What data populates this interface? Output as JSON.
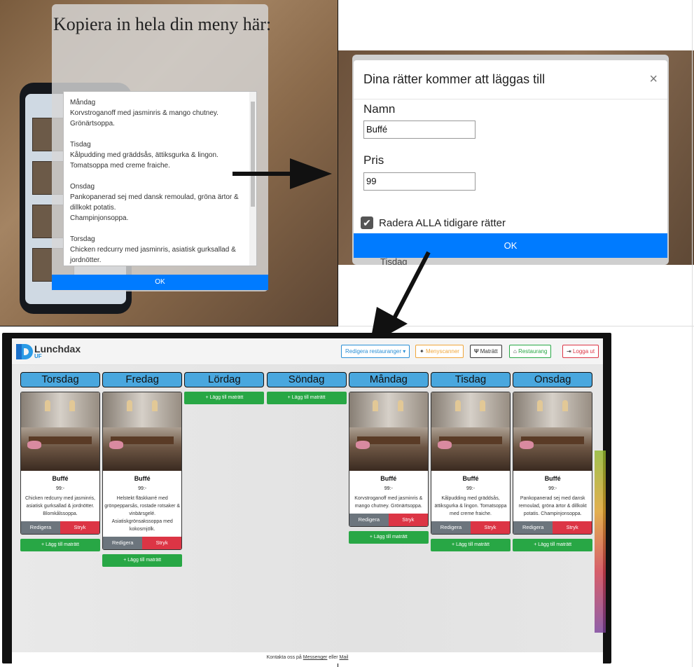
{
  "menu_paste": {
    "title": "Kopiera in hela din meny här:",
    "days": [
      {
        "day": "Måndag",
        "lines": [
          "Korvstroganoff med jasminris & mango chutney.",
          "Grönärtsoppa."
        ]
      },
      {
        "day": "Tisdag",
        "lines": [
          "Kålpudding med gräddsås, ättiksgurka & lingon.",
          "Tomatsoppa med creme fraiche."
        ]
      },
      {
        "day": "Onsdag",
        "lines": [
          "Pankopanerad sej med dansk remoulad, gröna ärtor & dillkokt potatis.",
          "Champinjonsoppa."
        ]
      },
      {
        "day": "Torsdag",
        "lines": [
          "Chicken redcurry med jasminris, asiatisk gurksallad & jordnötter."
        ]
      }
    ],
    "ok_label": "OK"
  },
  "dish_dialog": {
    "title": "Dina rätter kommer att läggas till",
    "close_symbol": "×",
    "name_label": "Namn",
    "name_value": "Buffé",
    "price_label": "Pris",
    "price_value": "99",
    "delete_all_label": "Radera ALLA tidigare rätter",
    "delete_all_checked": true,
    "ok_label": "OK",
    "background_day": "Tisdag"
  },
  "app": {
    "brand": "Lunchdax",
    "brand_sub": "UF",
    "nav": {
      "edit_restaurants": "Redigera restauranger",
      "menu_scanner": "Menyscanner",
      "dish": "Maträtt",
      "restaurant": "Restaurang",
      "logout": "Logga ut"
    },
    "nav_colors": {
      "edit_restaurants": "#2a8fd6",
      "menu_scanner": "#f0a63a",
      "dish": "#333333",
      "restaurant": "#28a745",
      "logout": "#dc3545"
    },
    "edit_label": "Redigera",
    "delete_label": "Stryk",
    "add_label": "+ Lägg till maträtt",
    "days": [
      {
        "name": "Torsdag",
        "dish": {
          "name": "Buffé",
          "price": "99:-",
          "desc": "Chicken redcurry med jasminris, asiatisk gurksallad & jordnötter. Blomkålssoppa."
        }
      },
      {
        "name": "Fredag",
        "dish": {
          "name": "Buffé",
          "price": "99:-",
          "desc": "Helstekt fläskkarré med grönpepparsås, rostade rotsaker & vinbärsgelé. Asiatiskgrönsakssoppa med kokosmjölk."
        }
      },
      {
        "name": "Lördag",
        "dish": null
      },
      {
        "name": "Söndag",
        "dish": null
      },
      {
        "name": "Måndag",
        "dish": {
          "name": "Buffé",
          "price": "99:-",
          "desc": "Korvstroganoff med jasminris & mango chutney. Grönärtsoppa."
        }
      },
      {
        "name": "Tisdag",
        "dish": {
          "name": "Buffé",
          "price": "99:-",
          "desc": "Kålpudding med gräddsås, ättiksgurka & lingon. Tomatsoppa med creme fraiche."
        }
      },
      {
        "name": "Onsdag",
        "dish": {
          "name": "Buffé",
          "price": "99:-",
          "desc": "Pankopanerad sej med dansk remoulad, gröna ärtor & dillkokt potatis. Champinjonsoppa."
        }
      }
    ],
    "footer": {
      "prefix": "Kontakta oss på",
      "link1": "Messenger",
      "middle": "eller",
      "link2": "Mail"
    }
  }
}
